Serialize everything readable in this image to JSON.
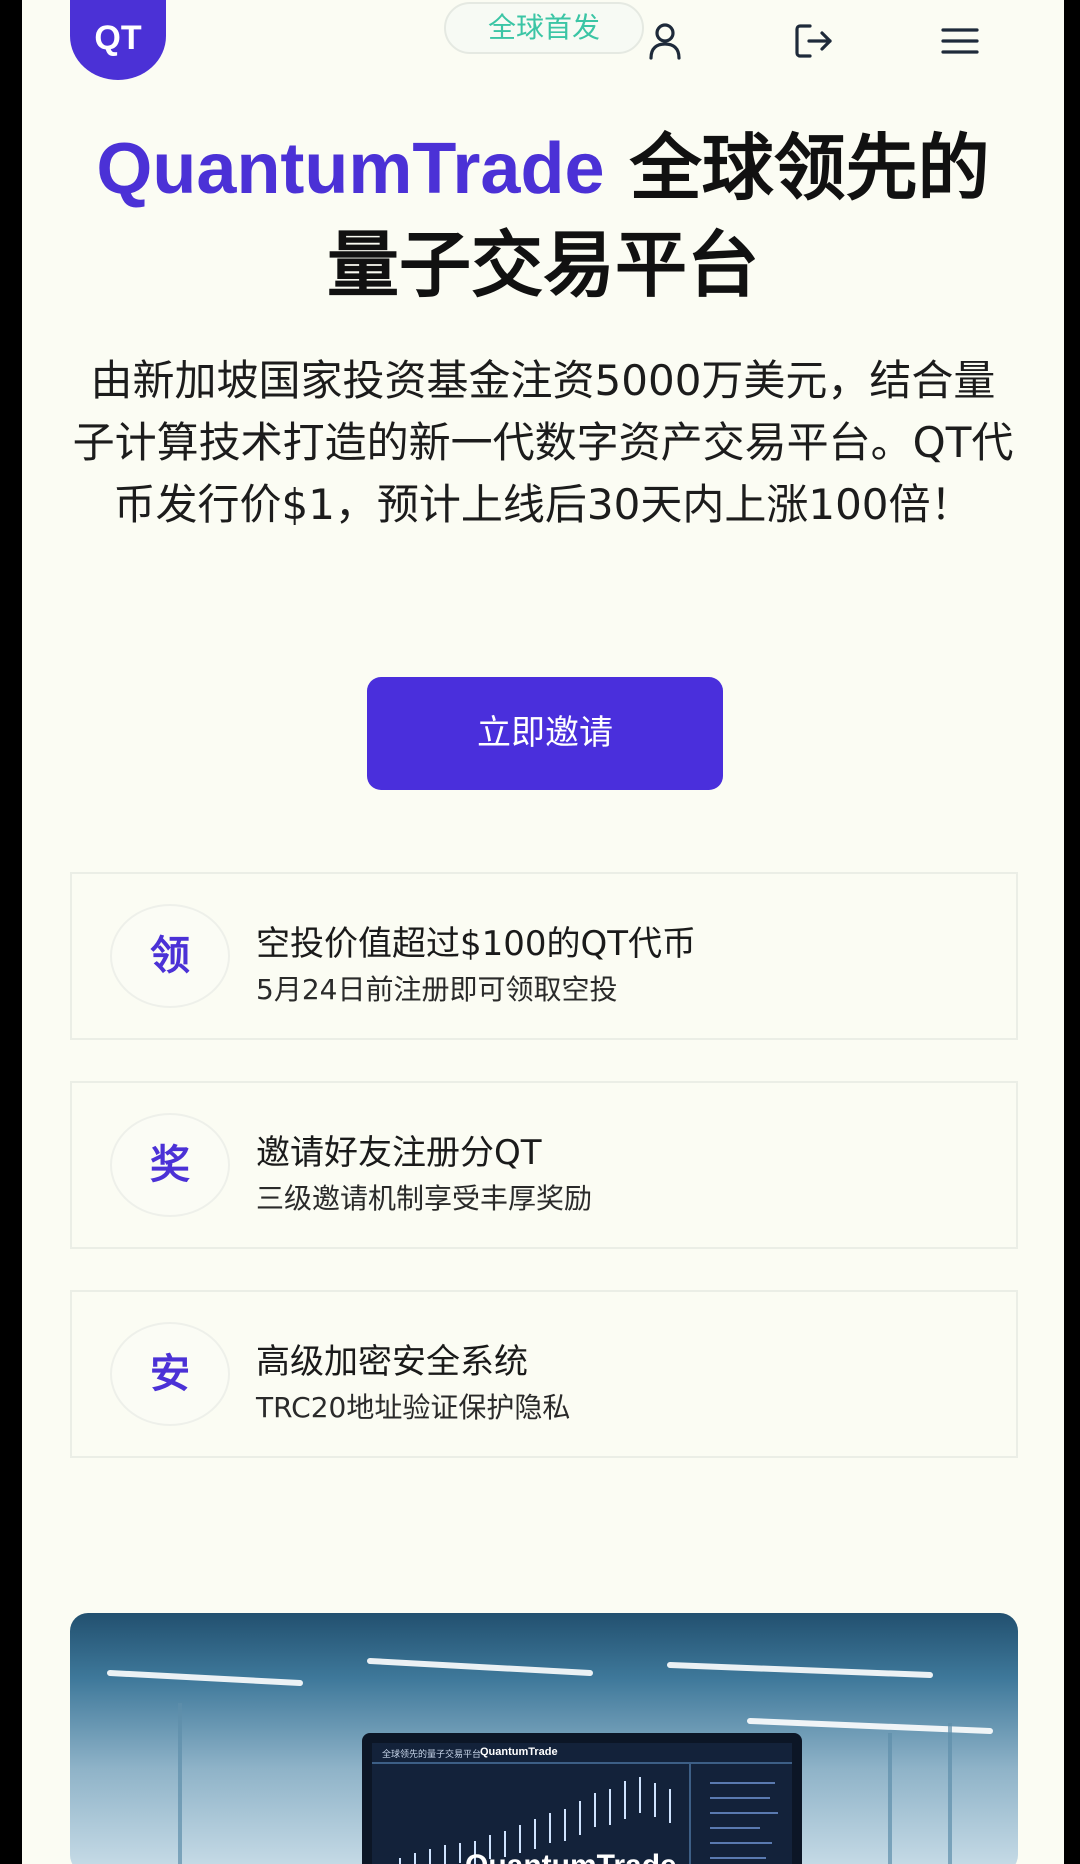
{
  "header": {
    "logo_text": "QT",
    "badge": "全球首发",
    "icons": [
      "user-icon",
      "logout-icon",
      "menu-icon"
    ]
  },
  "hero": {
    "title_brand": "QuantumTrade",
    "title_rest": " 全球领先的量子交易平台",
    "description": "由新加坡国家投资基金注资5000万美元，结合量子计算技术打造的新一代数字资产交易平台。QT代币发行价$1，预计上线后30天内上涨100倍！",
    "cta_label": "立即邀请"
  },
  "features": [
    {
      "icon": "领",
      "title": "空投价值超过$100的QT代币",
      "subtitle": "5月24日前注册即可领取空投"
    },
    {
      "icon": "奖",
      "title": "邀请好友注册分QT",
      "subtitle": "三级邀请机制享受丰厚奖励"
    },
    {
      "icon": "安",
      "title": "高级加密安全系统",
      "subtitle": "TRC20地址验证保护隐私"
    }
  ],
  "photo": {
    "screen_brand": "QuantumTrade",
    "screen_header_left": "全球领先的量子交易平台",
    "screen_header_mid": "QuantumTrade"
  },
  "colors": {
    "brand": "#4b31d6",
    "badge_text": "#3bc5a5",
    "page_bg": "#fbfcf3"
  }
}
